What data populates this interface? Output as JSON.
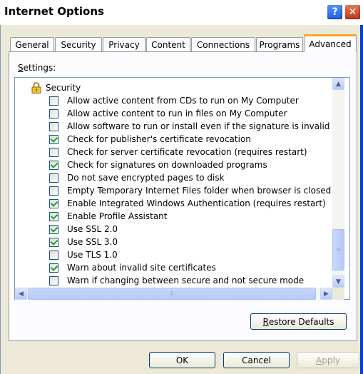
{
  "window": {
    "title": "Internet Options",
    "help_label": "?",
    "close_label": "✕"
  },
  "tabs": [
    {
      "label": "General",
      "active": false
    },
    {
      "label": "Security",
      "active": false
    },
    {
      "label": "Privacy",
      "active": false
    },
    {
      "label": "Content",
      "active": false
    },
    {
      "label": "Connections",
      "active": false
    },
    {
      "label": "Programs",
      "active": false
    },
    {
      "label": "Advanced",
      "active": true
    }
  ],
  "settings": {
    "label_first": "S",
    "label_rest": "ettings:",
    "group": {
      "label": "Security",
      "icon": "lock-icon"
    },
    "items": [
      {
        "label": "Allow active content from CDs to run on My Computer",
        "checked": false
      },
      {
        "label": "Allow active content to run in files on My Computer",
        "checked": false
      },
      {
        "label": "Allow software to run or install even if the signature is invalid",
        "checked": false
      },
      {
        "label": "Check for publisher's certificate revocation",
        "checked": true
      },
      {
        "label": "Check for server certificate revocation (requires restart)",
        "checked": false
      },
      {
        "label": "Check for signatures on downloaded programs",
        "checked": true
      },
      {
        "label": "Do not save encrypted pages to disk",
        "checked": false
      },
      {
        "label": "Empty Temporary Internet Files folder when browser is closed",
        "checked": false
      },
      {
        "label": "Enable Integrated Windows Authentication (requires restart)",
        "checked": true
      },
      {
        "label": "Enable Profile Assistant",
        "checked": true
      },
      {
        "label": "Use SSL 2.0",
        "checked": true
      },
      {
        "label": "Use SSL 3.0",
        "checked": true
      },
      {
        "label": "Use TLS 1.0",
        "checked": false
      },
      {
        "label": "Warn about invalid site certificates",
        "checked": true
      },
      {
        "label": "Warn if changing between secure and not secure mode",
        "checked": false
      }
    ]
  },
  "buttons": {
    "restore_first": "R",
    "restore_rest": "estore Defaults",
    "ok": "OK",
    "cancel": "Cancel",
    "apply_first": "A",
    "apply_rest": "pply"
  },
  "colors": {
    "titlebar_blue": "#0a3fc7",
    "active_tab_accent": "#f5a623",
    "check_green": "#21a121"
  }
}
